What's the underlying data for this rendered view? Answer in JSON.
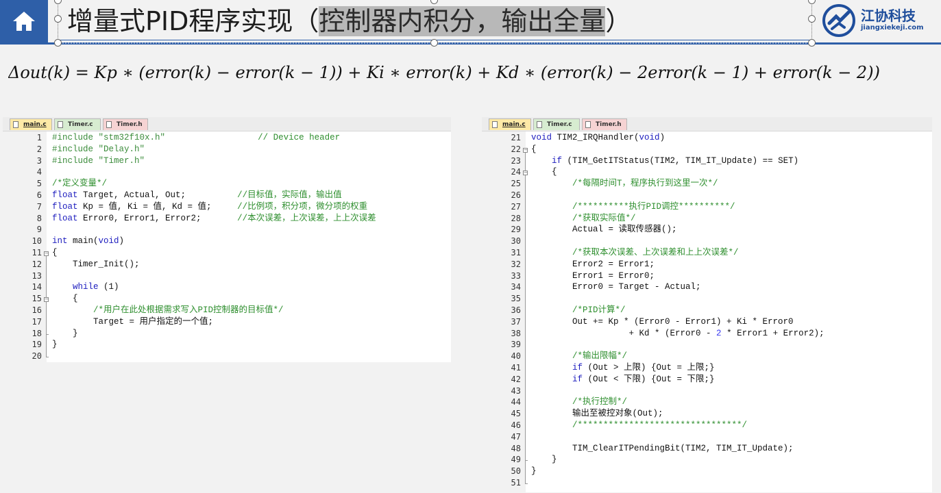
{
  "header": {
    "title_prefix": "增量式PID程序实现（",
    "title_highlight": "控制器内积分，输出全量",
    "title_suffix": "）",
    "logo_cn": "江协科技",
    "logo_en": "jiangxiekeji.com",
    "colors": {
      "brand": "#2e5fa8",
      "home_bg": "#2e5fa8"
    },
    "icons": {
      "home": "home-icon",
      "logo": "logo-icon"
    }
  },
  "formula": "Δout(k) = Kp ∗ (error(k) − error(k − 1)) + Ki ∗ error(k) + Kd ∗ (error(k) − 2error(k − 1) + error(k − 2))",
  "left_panel": {
    "tabs": [
      {
        "label": "main.c",
        "active": true
      },
      {
        "label": "Timer.c",
        "active": false
      },
      {
        "label": "Timer.h",
        "active": false
      }
    ],
    "line_numbers": [
      "1",
      "2",
      "3",
      "4",
      "5",
      "6",
      "7",
      "8",
      "9",
      "10",
      "11",
      "12",
      "13",
      "14",
      "15",
      "16",
      "17",
      "18",
      "19",
      "20"
    ],
    "lines": [
      "#include \"stm32f10x.h\"                  // Device header",
      "#include \"Delay.h\"",
      "#include \"Timer.h\"",
      "",
      "/*定义变量*/",
      "float Target, Actual, Out;          //目标值，实际值，输出值",
      "float Kp = 值, Ki = 值, Kd = 值;     //比例项，积分项，微分项的权重",
      "float Error0, Error1, Error2;       //本次误差，上次误差，上上次误差",
      "",
      "int main(void)",
      "{",
      "    Timer_Init();",
      "",
      "    while (1)",
      "    {",
      "        /*用户在此处根据需求写入PID控制器的目标值*/",
      "        Target = 用户指定的一个值;",
      "    }",
      "}",
      ""
    ]
  },
  "right_panel": {
    "tabs": [
      {
        "label": "main.c",
        "active": true
      },
      {
        "label": "Timer.c",
        "active": false
      },
      {
        "label": "Timer.h",
        "active": false
      }
    ],
    "line_numbers": [
      "21",
      "22",
      "23",
      "24",
      "25",
      "26",
      "27",
      "28",
      "29",
      "30",
      "31",
      "32",
      "33",
      "34",
      "35",
      "36",
      "37",
      "38",
      "39",
      "40",
      "41",
      "42",
      "43",
      "44",
      "45",
      "46",
      "47",
      "48",
      "49",
      "50",
      "51"
    ],
    "lines": [
      "void TIM2_IRQHandler(void)",
      "{",
      "    if (TIM_GetITStatus(TIM2, TIM_IT_Update) == SET)",
      "    {",
      "        /*每隔时间T，程序执行到这里一次*/",
      "",
      "        /**********执行PID调控**********/",
      "        /*获取实际值*/",
      "        Actual = 读取传感器();",
      "",
      "        /*获取本次误差、上次误差和上上次误差*/",
      "        Error2 = Error1;",
      "        Error1 = Error0;",
      "        Error0 = Target - Actual;",
      "",
      "        /*PID计算*/",
      "        Out += Kp * (Error0 - Error1) + Ki * Error0",
      "                   + Kd * (Error0 - 2 * Error1 + Error2);",
      "",
      "        /*输出限幅*/",
      "        if (Out > 上限) {Out = 上限;}",
      "        if (Out < 下限) {Out = 下限;}",
      "",
      "        /*执行控制*/",
      "        输出至被控对象(Out);",
      "        /********************************/",
      "",
      "        TIM_ClearITPendingBit(TIM2, TIM_IT_Update);",
      "    }",
      "}",
      ""
    ]
  }
}
